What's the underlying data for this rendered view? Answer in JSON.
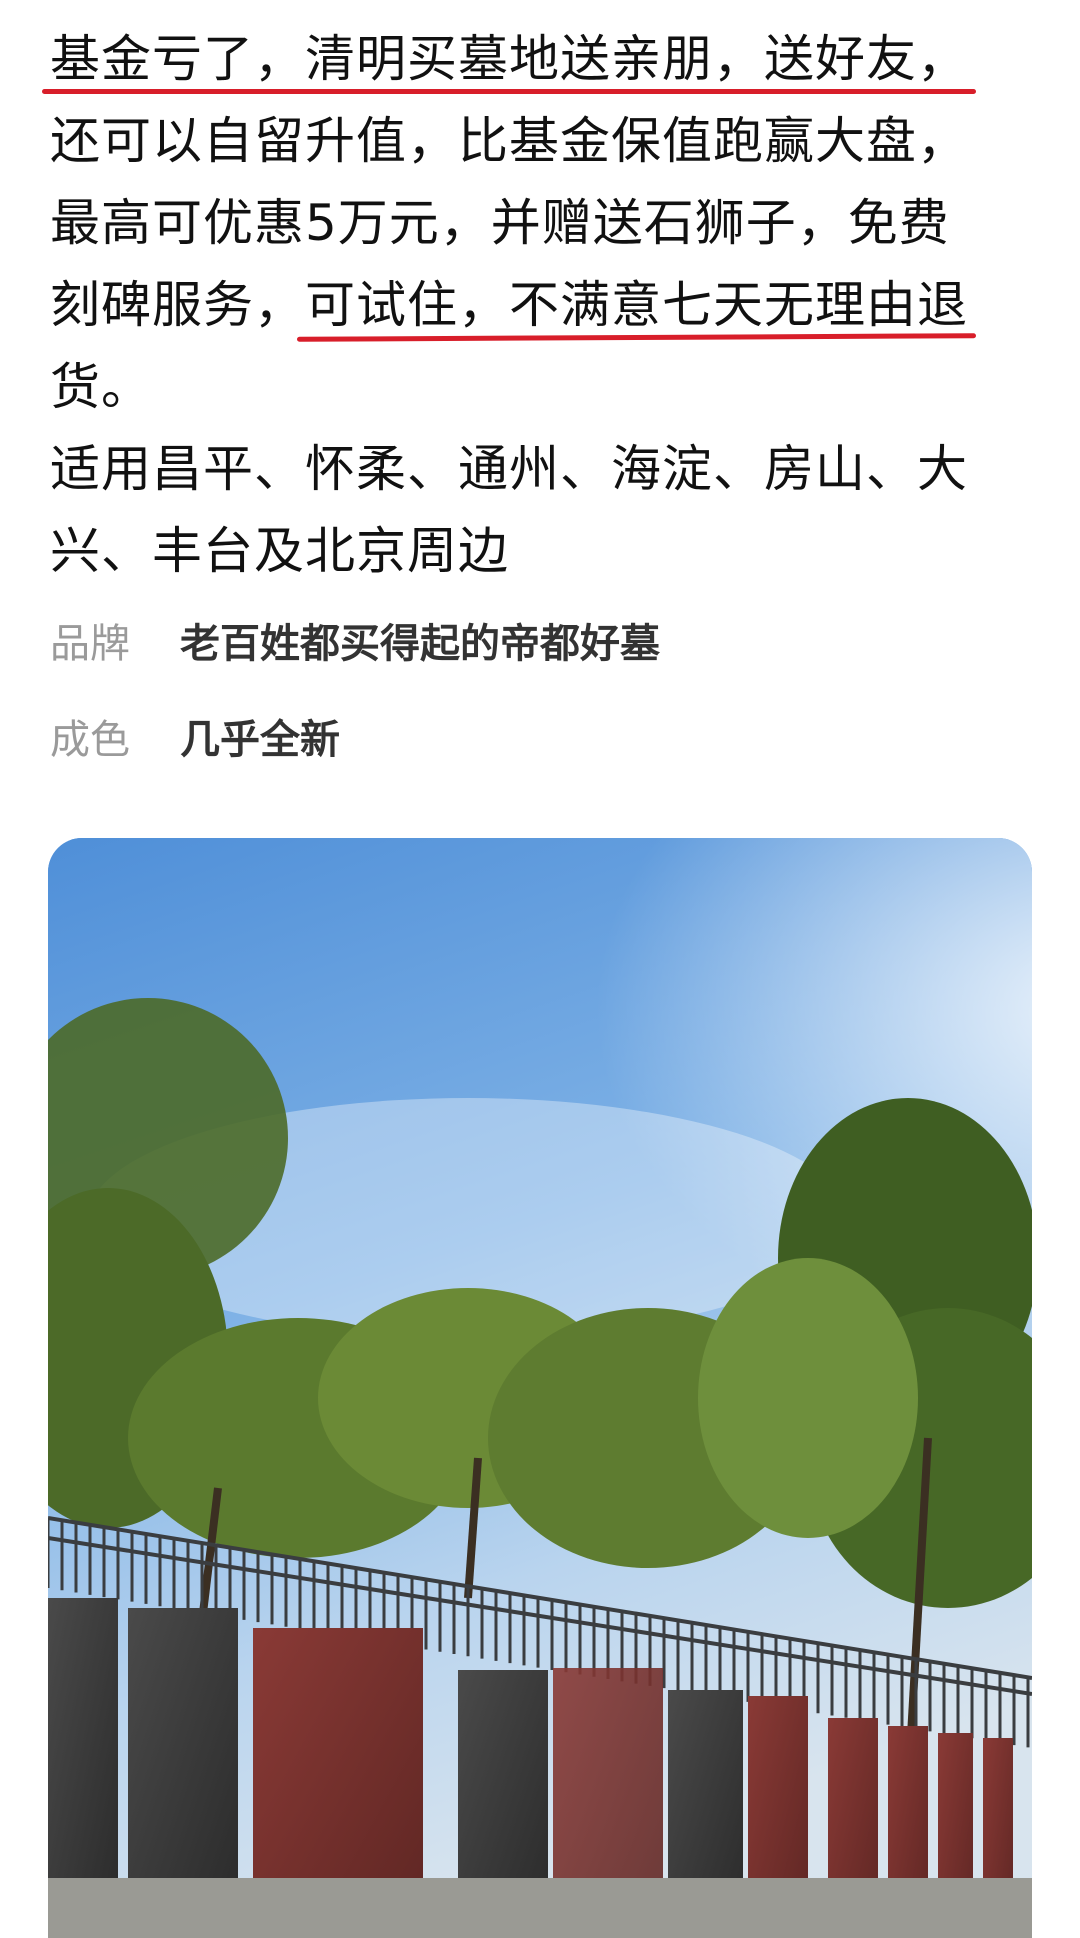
{
  "description": {
    "line1_a": "基金亏了，清明买墓地送亲朋，送好友，",
    "line2": "还可以自留升值，比基金保值跑赢大盘，",
    "line3": "最高可优惠5万元，并赠送石狮子，免费",
    "line4_a": "刻碑服务，",
    "line4_b": "可试住，不满意七天无理由退",
    "line5": "货。",
    "line6": "适用昌平、怀柔、通州、海淀、房山、大",
    "line7": "兴、丰台及北京周边"
  },
  "attributes": [
    {
      "label": "品牌",
      "value": "老百姓都买得起的帝都好墓"
    },
    {
      "label": "成色",
      "value": "几乎全新"
    }
  ],
  "colors": {
    "underline": "#d81e2a",
    "label": "#9a9a9a",
    "value": "#333333"
  },
  "photo": {
    "subject": "cemetery-photo"
  }
}
